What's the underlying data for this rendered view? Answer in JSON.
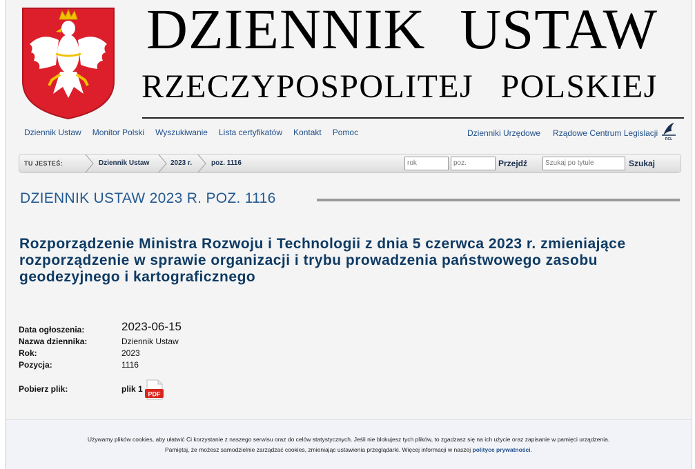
{
  "masthead": {
    "title": "DZIENNIK USTAW",
    "subtitle": "RZECZYPOSPOLITEJ POLSKIEJ",
    "emblem_icon": "polish-eagle-emblem",
    "emblem_bg": "#dc1f2b"
  },
  "nav": {
    "left": [
      "Dziennik Ustaw",
      "Monitor Polski",
      "Wyszukiwanie",
      "Lista certyfikatów",
      "Kontakt",
      "Pomoc"
    ],
    "right": [
      "Dzienniki Urzędowe",
      "Rządowe Centrum Legislacji"
    ],
    "rcl_icon": "rcl-logo-icon",
    "link_color": "#1f4f8a"
  },
  "breadcrumb": {
    "label": "TU JESTEŚ:",
    "items": [
      "Dziennik Ustaw",
      "2023 r.",
      "poz. 1116"
    ],
    "year_placeholder": "rok",
    "pos_placeholder": "poz.",
    "go_label": "Przejdź",
    "search_placeholder": "Szukaj po tytule",
    "search_label": "Szukaj"
  },
  "doc": {
    "heading": "DZIENNIK USTAW 2023 R. POZ. 1116",
    "title": "Rozporządzenie Ministra Rozwoju i Technologii z dnia 5 czerwca 2023 r. zmieniające rozporządzenie w sprawie organizacji i trybu prowadzenia państwowego zasobu geodezyjnego i kartograficznego",
    "heading_color": "#245a91",
    "title_color": "#0e3a63"
  },
  "meta": {
    "date_label": "Data ogłoszenia:",
    "date_value": "2023-06-15",
    "journal_label": "Nazwa dziennika:",
    "journal_value": "Dziennik Ustaw",
    "year_label": "Rok:",
    "year_value": "2023",
    "position_label": "Pozycja:",
    "position_value": "1116",
    "download_label": "Pobierz plik:",
    "file_label": "plik 1",
    "file_icon": "pdf-icon"
  },
  "cookie": {
    "line1": "Używamy plików cookies, aby ułatwić Ci korzystanie z naszego serwisu oraz do celów statystycznych. Jeśli nie blokujesz tych plików, to zgadzasz się na ich użycie oraz zapisanie w pamięci urządzenia.",
    "line2_prefix": "Pamiętaj, że możesz samodzielnie zarządzać cookies, zmieniając ustawienia przeglądarki. Więcej informacji w naszej",
    "policy_link": "polityce prywatności",
    "line2_suffix": "."
  }
}
